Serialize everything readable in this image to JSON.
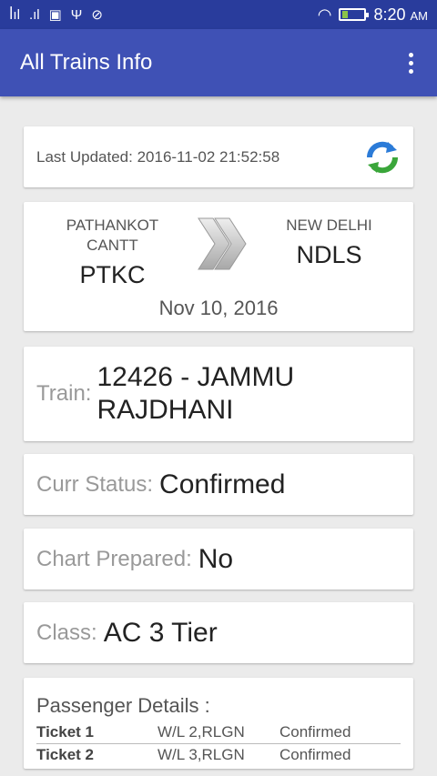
{
  "status_bar": {
    "time": "8:20",
    "ampm": "AM"
  },
  "app_bar": {
    "title": "All Trains Info"
  },
  "last_updated": {
    "label": "Last Updated: 2016-11-02 21:52:58"
  },
  "route": {
    "from_name": "PATHANKOT CANTT",
    "from_code": "PTKC",
    "to_name": "NEW DELHI",
    "to_code": "NDLS",
    "date": "Nov 10, 2016"
  },
  "train": {
    "label": "Train:",
    "value_line1": "12426 - JAMMU",
    "value_line2": "RAJDHANI"
  },
  "current_status": {
    "label": "Curr Status:",
    "value": "Confirmed"
  },
  "chart_prepared": {
    "label": "Chart Prepared:",
    "value": "No"
  },
  "travel_class": {
    "label": "Class:",
    "value": "AC 3 Tier"
  },
  "passengers": {
    "title": "Passenger Details :",
    "rows": [
      {
        "ticket": "Ticket 1",
        "booking": "W/L 2,RLGN",
        "status": "Confirmed"
      },
      {
        "ticket": "Ticket 2",
        "booking": "W/L 3,RLGN",
        "status": "Confirmed"
      }
    ]
  }
}
